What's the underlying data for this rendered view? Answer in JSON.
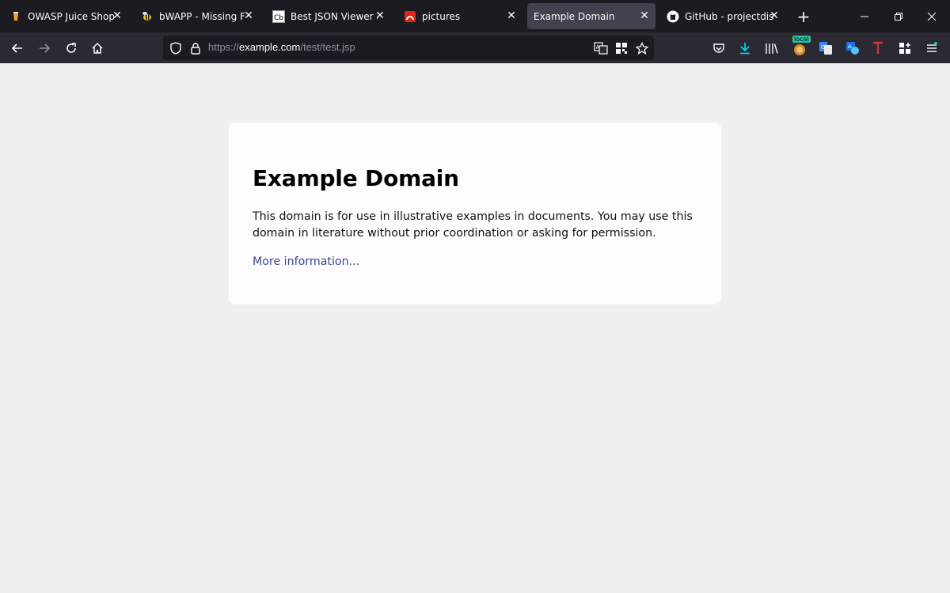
{
  "tabs": [
    {
      "title": "OWASP Juice Shop",
      "favicon": "juice-shop-icon",
      "active": false
    },
    {
      "title": "bWAPP - Missing Func",
      "favicon": "bee-icon",
      "active": false
    },
    {
      "title": "Best JSON Viewer and",
      "favicon": "cb-icon",
      "active": false
    },
    {
      "title": "pictures",
      "favicon": "pictures-icon",
      "active": false
    },
    {
      "title": "Example Domain",
      "favicon": "",
      "active": true
    },
    {
      "title": "GitHub - projectdiscov",
      "favicon": "github-icon",
      "active": false
    }
  ],
  "url": {
    "scheme": "https://",
    "host": "example.com",
    "path": "/test/test.jsp"
  },
  "extensions": {
    "badge_label": "local"
  },
  "page": {
    "heading": "Example Domain",
    "paragraph": "This domain is for use in illustrative examples in documents. You may use this domain in literature without prior coordination or asking for permission.",
    "link": "More information..."
  },
  "colors": {
    "link": "#38488f",
    "active_tab": "#42414d",
    "download_icon": "#00ddff",
    "badge": "#2ac3a2"
  }
}
